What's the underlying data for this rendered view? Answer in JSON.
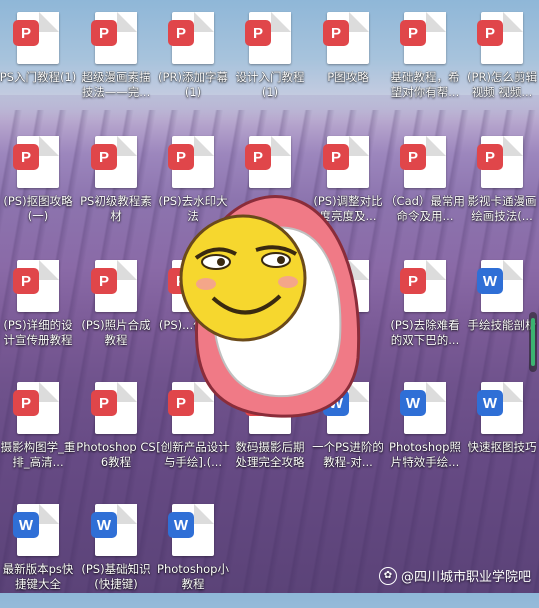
{
  "desktop": {
    "items": [
      {
        "label": "PS入门教程(1)",
        "type": "pdf",
        "col": 0,
        "row": 0
      },
      {
        "label": "超级漫画素描技法——完...",
        "type": "pdf",
        "col": 1,
        "row": 0
      },
      {
        "label": "(PR)添加字幕(1)",
        "type": "pdf",
        "col": 2,
        "row": 0
      },
      {
        "label": "设计入门教程(1)",
        "type": "pdf",
        "col": 3,
        "row": 0
      },
      {
        "label": "P图攻略",
        "type": "pdf",
        "col": 4,
        "row": 0
      },
      {
        "label": "基础教程，希望对你有帮...",
        "type": "pdf",
        "col": 5,
        "row": 0
      },
      {
        "label": "(PR)怎么剪辑视频 视频...",
        "type": "pdf",
        "col": 6,
        "row": 0
      },
      {
        "label": "(PS)抠图攻略(一)",
        "type": "pdf",
        "col": 0,
        "row": 1
      },
      {
        "label": "PS初级教程素材",
        "type": "pdf",
        "col": 1,
        "row": 1
      },
      {
        "label": "(PS)去水印大法",
        "type": "pdf",
        "col": 2,
        "row": 1
      },
      {
        "label": "",
        "type": "pdf",
        "col": 3,
        "row": 1
      },
      {
        "label": "(PS)调整对比度亮度及...",
        "type": "pdf",
        "col": 4,
        "row": 1
      },
      {
        "label": "（Cad）最常用命令及用...",
        "type": "pdf",
        "col": 5,
        "row": 1
      },
      {
        "label": "影视卡通漫画绘画技法(...",
        "type": "pdf",
        "col": 6,
        "row": 1
      },
      {
        "label": "(PS)详细的设计宣传册教程",
        "type": "pdf",
        "col": 0,
        "row": 2
      },
      {
        "label": "(PS)照片合成教程",
        "type": "pdf",
        "col": 1,
        "row": 2
      },
      {
        "label": "(PS)...作教...",
        "type": "pdf",
        "col": 2,
        "row": 2
      },
      {
        "label": "",
        "type": "pdf",
        "col": 3,
        "row": 2
      },
      {
        "label": "...套",
        "type": "pdf",
        "col": 4,
        "row": 2
      },
      {
        "label": "(PS)去除难看的双下巴的...",
        "type": "pdf",
        "col": 5,
        "row": 2
      },
      {
        "label": "手绘技能剖析",
        "type": "word",
        "col": 6,
        "row": 2
      },
      {
        "label": "摄影构图学_重排_高清...",
        "type": "pdf",
        "col": 0,
        "row": 3
      },
      {
        "label": "Photoshop CS6教程",
        "type": "pdf",
        "col": 1,
        "row": 3
      },
      {
        "label": "[创新产品设计与手绘].(...",
        "type": "pdf",
        "col": 2,
        "row": 3
      },
      {
        "label": "数码摄影后期处理完全攻略",
        "type": "pdf",
        "col": 3,
        "row": 3
      },
      {
        "label": "一个PS进阶的教程-对...",
        "type": "word",
        "col": 4,
        "row": 3
      },
      {
        "label": "Photoshop照片特效手绘...",
        "type": "word",
        "col": 5,
        "row": 3
      },
      {
        "label": "快速抠图技巧",
        "type": "word",
        "col": 6,
        "row": 3
      },
      {
        "label": "最新版本ps快捷键大全",
        "type": "word",
        "col": 0,
        "row": 4
      },
      {
        "label": "(PS)基础知识(快捷键)",
        "type": "word",
        "col": 1,
        "row": 4
      },
      {
        "label": "Photoshop小教程",
        "type": "word",
        "col": 2,
        "row": 4
      }
    ]
  },
  "watermark": {
    "text": "@四川城市职业学院吧",
    "icon": "paw-icon"
  },
  "colors": {
    "pdf": "#e0464a",
    "word": "#2f6fd6"
  }
}
